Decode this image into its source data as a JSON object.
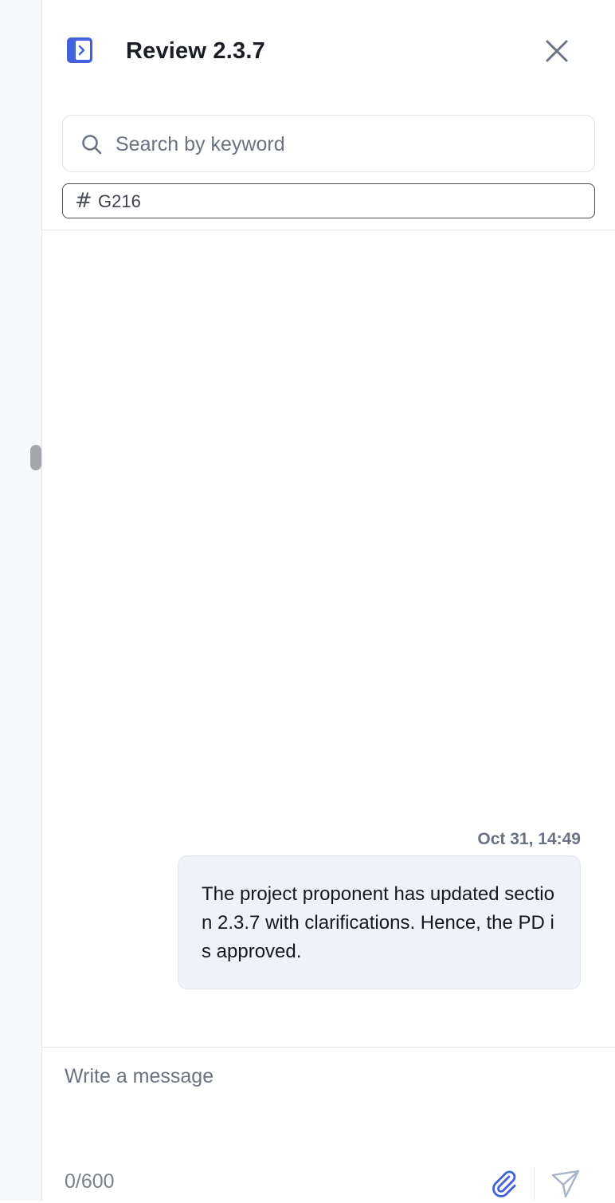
{
  "header": {
    "title": "Review 2.3.7",
    "collapse_icon": "sidebar-collapse-icon",
    "close_icon": "close-icon"
  },
  "search": {
    "placeholder": "Search by keyword",
    "value": ""
  },
  "tag_filter": {
    "symbol": "#",
    "label": "G216"
  },
  "messages": [
    {
      "timestamp": "Oct 31, 14:49",
      "text": "The project proponent has updated section 2.3.7 with clarifications. Hence, the PD is approved."
    }
  ],
  "composer": {
    "placeholder": "Write a message",
    "value": "",
    "counter": "0/600",
    "attach_icon": "paperclip-icon",
    "send_icon": "send-icon"
  },
  "colors": {
    "accent": "#4361d8",
    "bubble_bg": "#eff2f7",
    "muted_text": "#6b7280"
  }
}
